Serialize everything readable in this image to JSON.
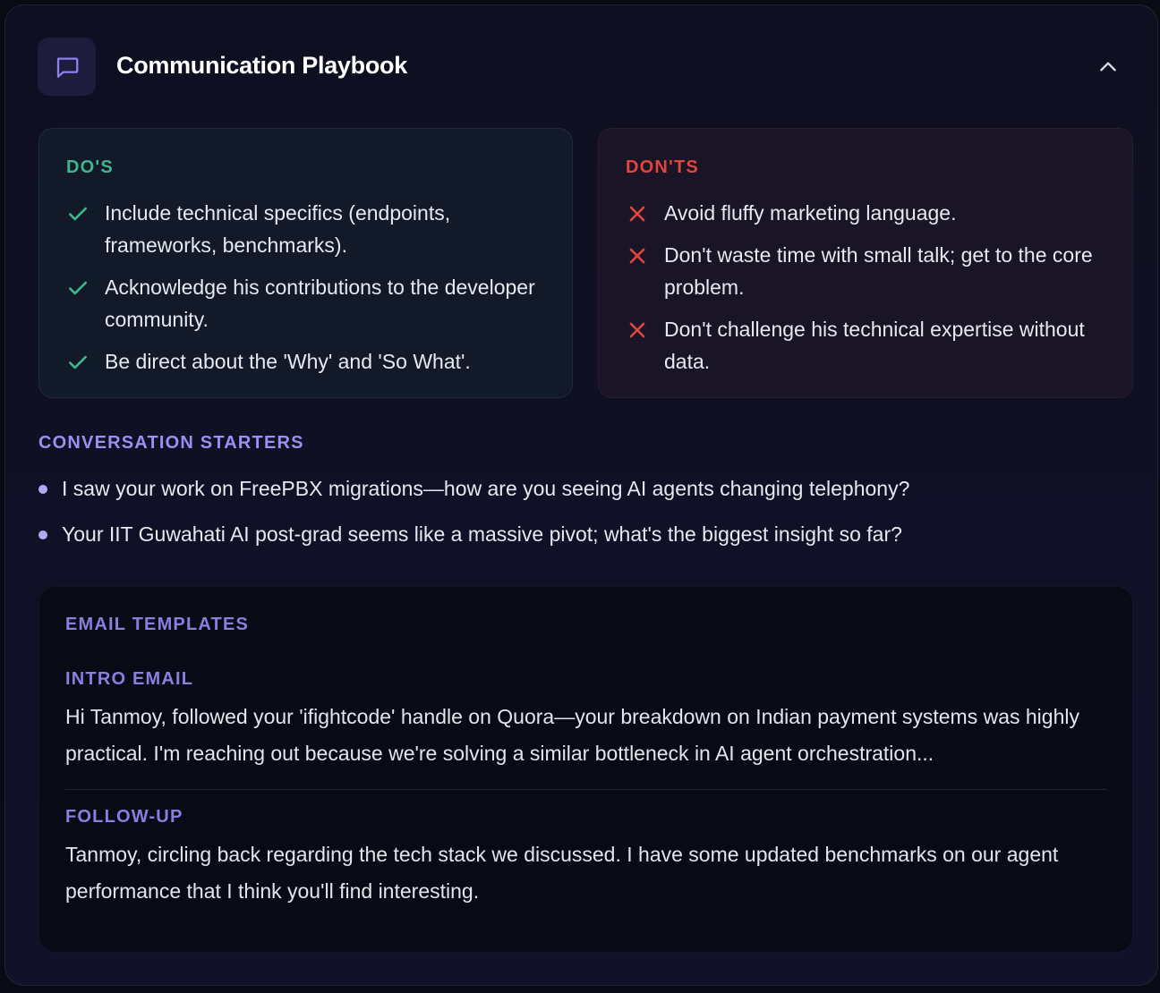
{
  "header": {
    "title": "Communication Playbook",
    "icon": "chat-bubble-icon",
    "collapse_icon": "chevron-up-icon"
  },
  "colors": {
    "dos_accent": "#3fb68b",
    "donts_accent": "#e0453f",
    "section_accent": "#9d8ff0"
  },
  "dos": {
    "heading": "DO'S",
    "items": [
      "Include technical specifics (endpoints, frameworks, benchmarks).",
      "Acknowledge his contributions to the developer community.",
      "Be direct about the 'Why' and 'So What'."
    ]
  },
  "donts": {
    "heading": "DON'TS",
    "items": [
      "Avoid fluffy marketing language.",
      "Don't waste time with small talk; get to the core problem.",
      "Don't challenge his technical expertise without data."
    ]
  },
  "starters": {
    "heading": "CONVERSATION STARTERS",
    "items": [
      "I saw your work on FreePBX migrations—how are you seeing AI agents changing telephony?",
      "Your IIT Guwahati AI post-grad seems like a massive pivot; what's the biggest insight so far?"
    ]
  },
  "templates": {
    "heading": "EMAIL TEMPLATES",
    "intro": {
      "label": "INTRO EMAIL",
      "body": "Hi Tanmoy, followed your 'ifightcode' handle on Quora—your breakdown on Indian payment systems was highly practical. I'm reaching out because we're solving a similar bottleneck in AI agent orchestration..."
    },
    "follow_up": {
      "label": "FOLLOW-UP",
      "body": "Tanmoy, circling back regarding the tech stack we discussed. I have some updated benchmarks on our agent performance that I think you'll find interesting."
    }
  }
}
